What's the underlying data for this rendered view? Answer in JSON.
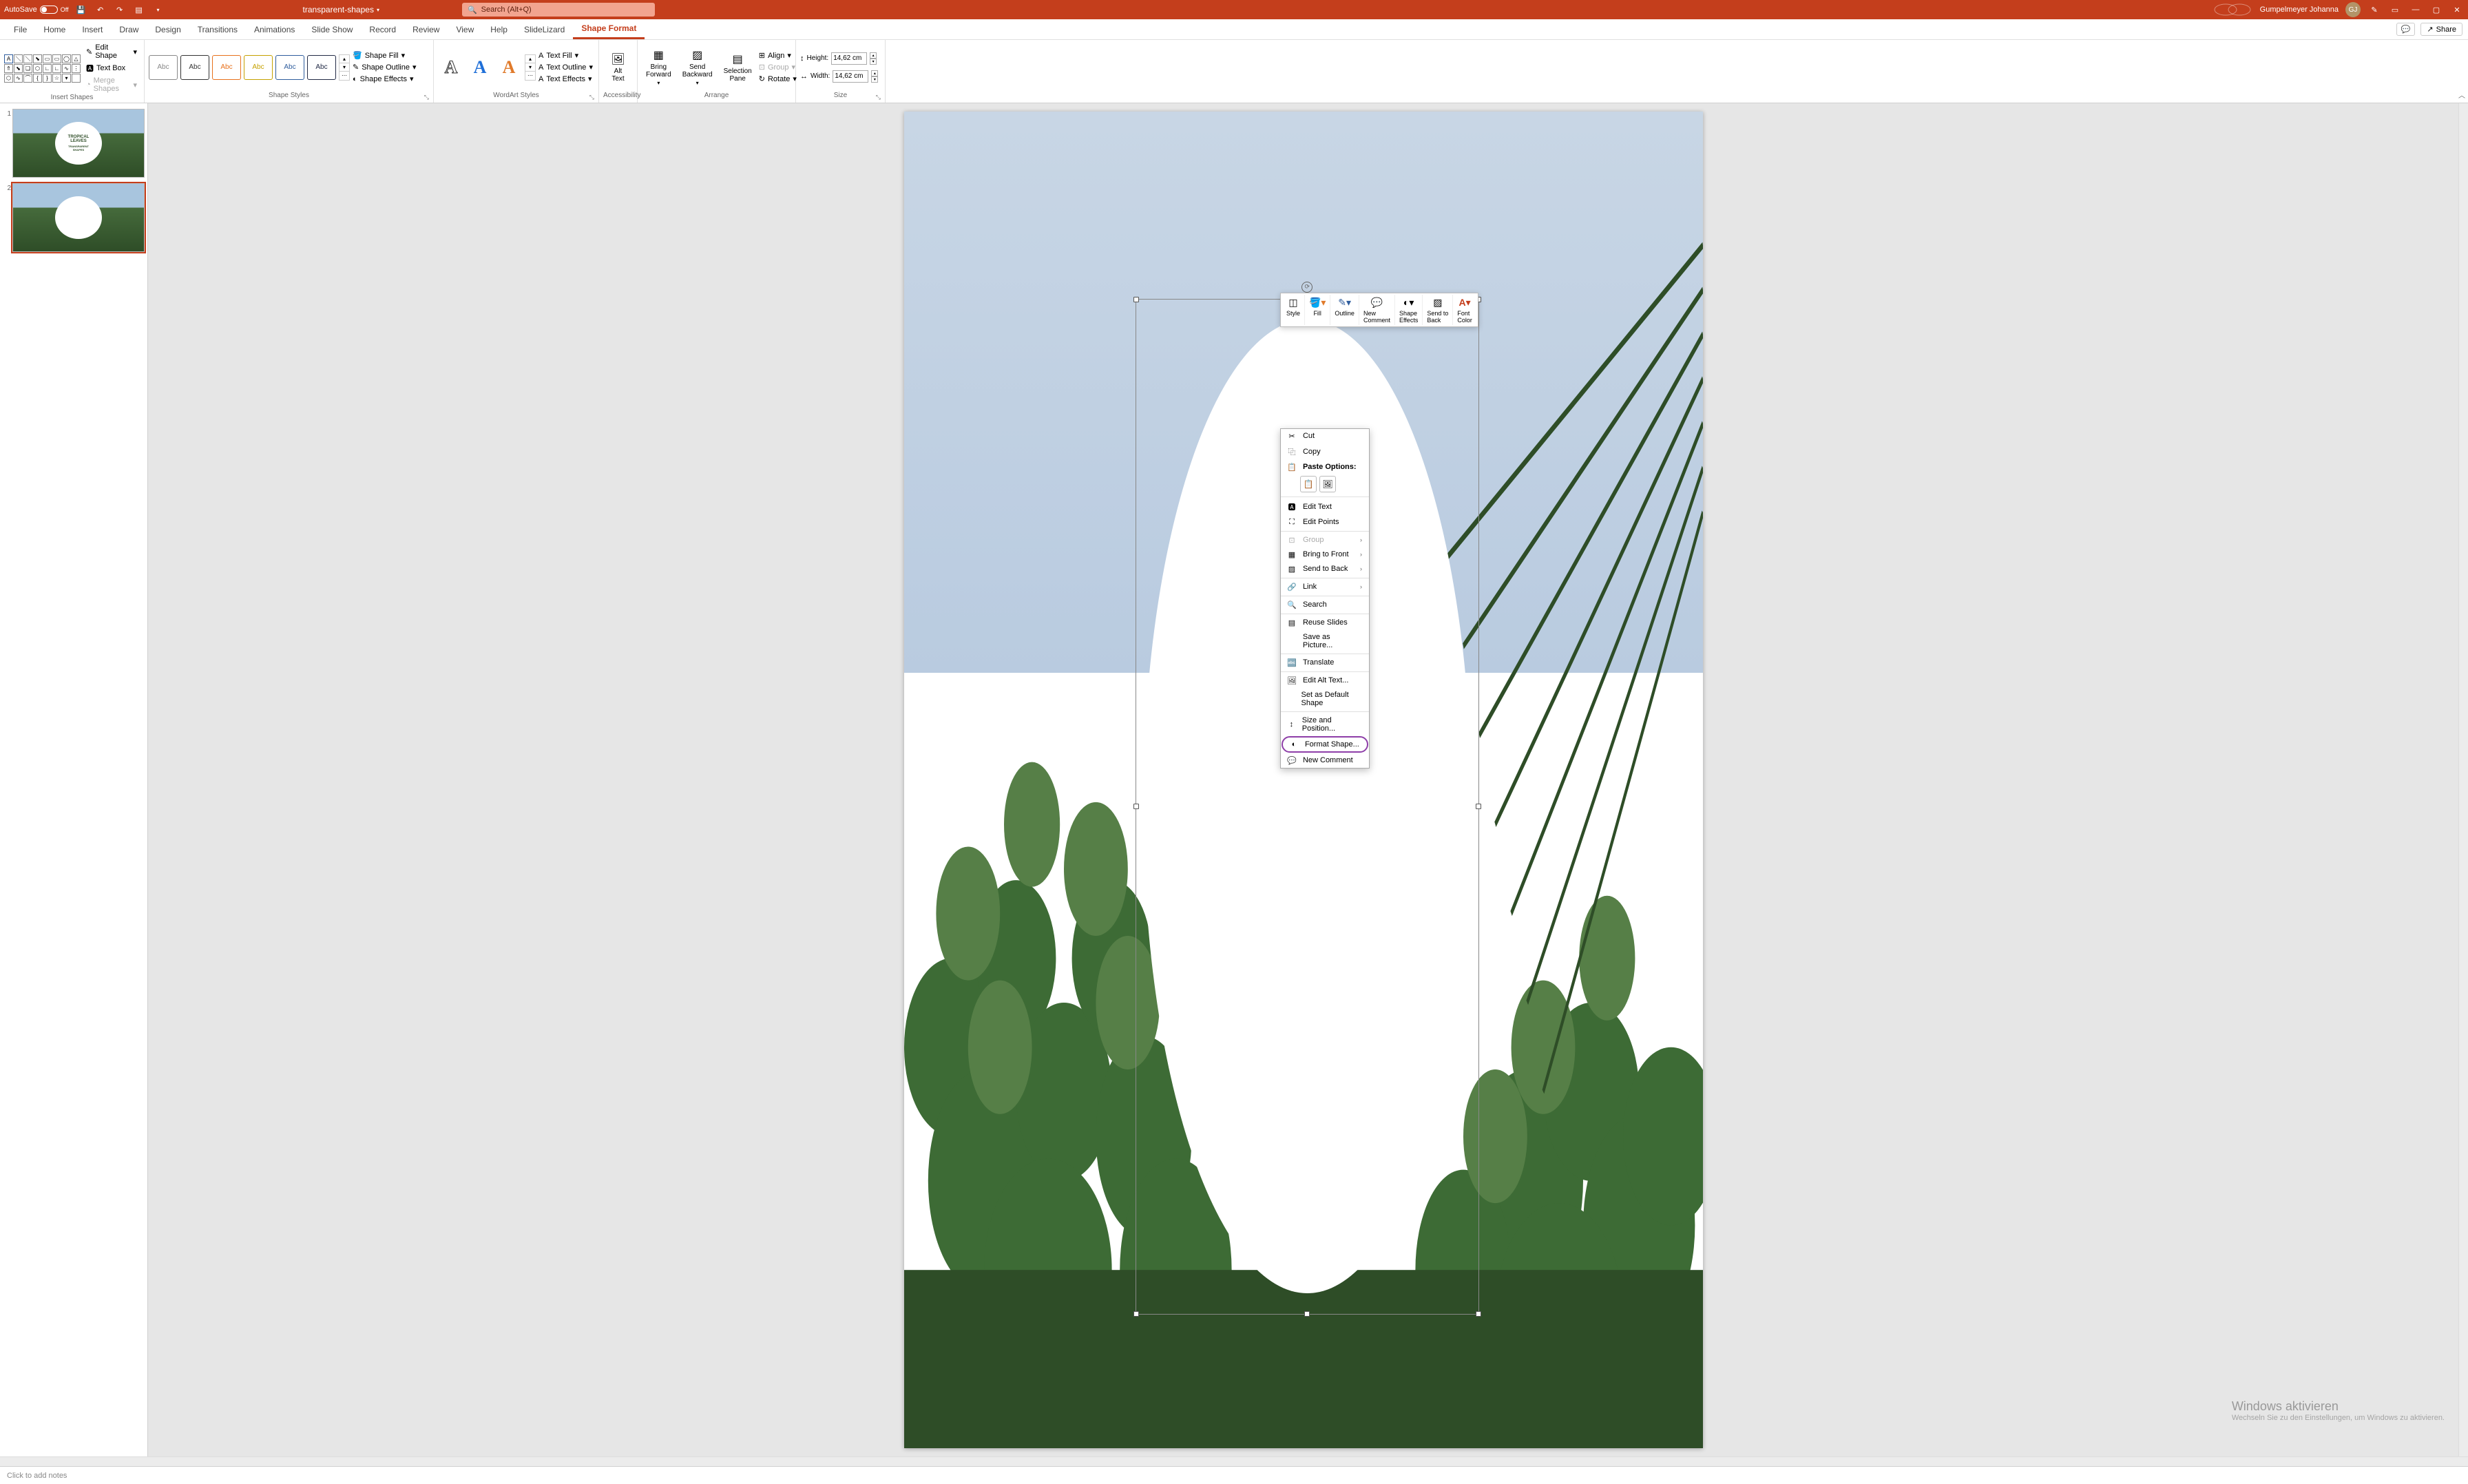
{
  "titlebar": {
    "autosave_label": "AutoSave",
    "autosave_state": "Off",
    "document_title": "transparent-shapes",
    "search_placeholder": "Search (Alt+Q)",
    "user_name": "Gumpelmeyer Johanna",
    "user_initials": "GJ"
  },
  "ribbon_tabs": {
    "file": "File",
    "home": "Home",
    "insert": "Insert",
    "draw": "Draw",
    "design": "Design",
    "transitions": "Transitions",
    "animations": "Animations",
    "slideshow": "Slide Show",
    "record": "Record",
    "review": "Review",
    "view": "View",
    "help": "Help",
    "slidelizard": "SlideLizard",
    "shape_format": "Shape Format",
    "comments_btn": "",
    "share_btn": "Share"
  },
  "ribbon": {
    "insert_shapes": {
      "edit_shape": "Edit Shape",
      "text_box": "Text Box",
      "merge_shapes": "Merge Shapes",
      "group_label": "Insert Shapes"
    },
    "shape_styles": {
      "swatch_label": "Abc",
      "shape_fill": "Shape Fill",
      "shape_outline": "Shape Outline",
      "shape_effects": "Shape Effects",
      "group_label": "Shape Styles"
    },
    "wordart_styles": {
      "glyph": "A",
      "text_fill": "Text Fill",
      "text_outline": "Text Outline",
      "text_effects": "Text Effects",
      "group_label": "WordArt Styles"
    },
    "accessibility": {
      "alt_text": "Alt\nText",
      "group_label": "Accessibility"
    },
    "arrange": {
      "bring_forward": "Bring\nForward",
      "send_backward": "Send\nBackward",
      "selection_pane": "Selection\nPane",
      "align": "Align",
      "group": "Group",
      "rotate": "Rotate",
      "group_label": "Arrange"
    },
    "size": {
      "height_label": "Height:",
      "height_value": "14,62 cm",
      "width_label": "Width:",
      "width_value": "14,62 cm",
      "group_label": "Size"
    }
  },
  "thumbnails": {
    "slide1": {
      "num": "1",
      "title": "TROPICAL\nLEAVES",
      "subtitle": "TRANSPARENT\nSHAPES"
    },
    "slide2": {
      "num": "2"
    }
  },
  "mini_toolbar": {
    "style": "Style",
    "fill": "Fill",
    "outline": "Outline",
    "new_comment": "New\nComment",
    "shape_effects": "Shape\nEffects",
    "send_to_back": "Send to\nBack",
    "font_color": "Font\nColor"
  },
  "context_menu": {
    "cut": "Cut",
    "copy": "Copy",
    "paste_options": "Paste Options:",
    "edit_text": "Edit Text",
    "edit_points": "Edit Points",
    "group": "Group",
    "bring_to_front": "Bring to Front",
    "send_to_back": "Send to Back",
    "link": "Link",
    "search": "Search",
    "reuse_slides": "Reuse Slides",
    "save_as_picture": "Save as Picture...",
    "translate": "Translate",
    "edit_alt_text": "Edit Alt Text...",
    "set_default": "Set as Default Shape",
    "size_position": "Size and Position...",
    "format_shape": "Format Shape...",
    "new_comment": "New Comment"
  },
  "notes": {
    "placeholder": "Click to add notes"
  },
  "watermark": {
    "line1": "Windows aktivieren",
    "line2": "Wechseln Sie zu den Einstellungen, um Windows zu aktivieren."
  }
}
